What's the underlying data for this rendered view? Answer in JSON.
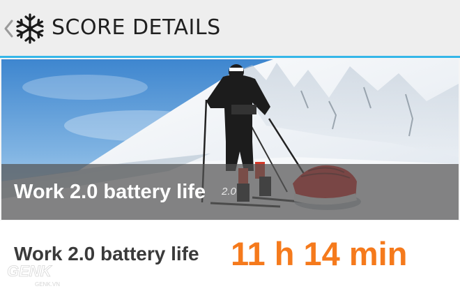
{
  "header": {
    "title": "SCORE DETAILS",
    "accent_color": "#35b6e8",
    "back_icon": "chevron-left-icon",
    "app_icon": "snowflake-icon"
  },
  "hero": {
    "label": "Work 2.0 battery life",
    "version": "2.0"
  },
  "result": {
    "label": "Work 2.0 battery life",
    "value": "11 h 14 min",
    "value_color": "#f57a1c"
  },
  "watermark": {
    "brand": "GENK",
    "domain": "GENK.VN"
  }
}
